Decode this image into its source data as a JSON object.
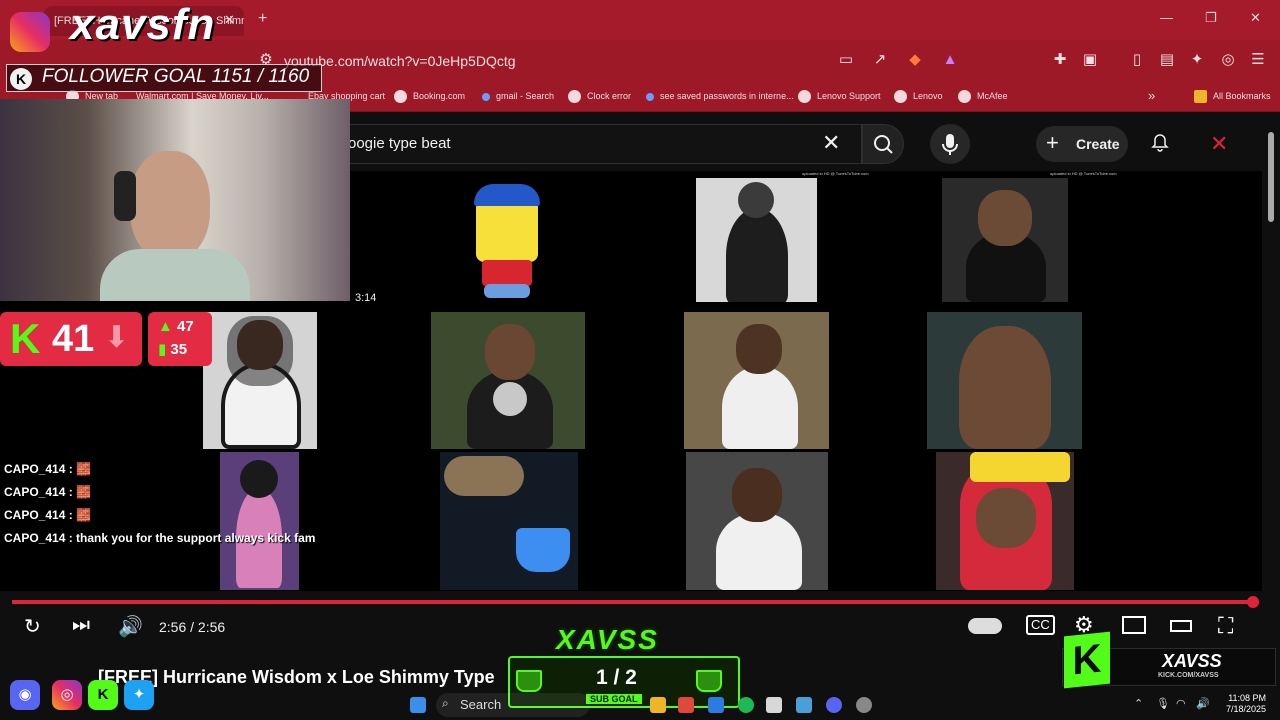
{
  "browser": {
    "tab_title": "[FREE] Hurricane Wisdom x Loe Shimmy",
    "url": "youtube.com/watch?v=0JeHp5DQctg",
    "bookmarks": [
      "New tab",
      "Walmart.com | Save Money. Liv...",
      "Ebay shopping cart",
      "Booking.com",
      "gmail - Search",
      "Clock error",
      "see saved passwords in interne...",
      "Lenovo Support",
      "Lenovo",
      "McAfee"
    ],
    "all_bookmarks": "All Bookmarks"
  },
  "youtube": {
    "search_query": "oogie type beat",
    "create_label": "Create",
    "thumb_duration": "3:14",
    "uploaded_note": "uploaded in HD @ TunesToTube.com",
    "time": "2:56 / 2:56",
    "video_title": "[FREE] Hurricane Wisdom x Loe Shimmy Type"
  },
  "stream": {
    "brand": "xavsfn",
    "follower_goal": "FOLLOWER GOAL 1151 / 1160",
    "viewers": "41",
    "stat_up": "47",
    "stat_bars": "35",
    "chat": [
      {
        "user": "CAPO_414",
        "msg": "🧱"
      },
      {
        "user": "CAPO_414",
        "msg": "🧱"
      },
      {
        "user": "CAPO_414",
        "msg": "🧱"
      },
      {
        "user": "CAPO_414",
        "msg": "thank you for the support always kick fam"
      }
    ],
    "sub_goal_title": "XAVSS",
    "sub_goal_count": "1 / 2",
    "sub_goal_label": "SUB GOAL",
    "kick_name": "XAVSS",
    "kick_url": "KICK.COM/XAVSS"
  },
  "taskbar": {
    "search": "Search",
    "clock_time": "11:08 PM",
    "clock_date": "7/18/2025"
  },
  "colors": {
    "chrome_red": "#a61b2c",
    "kick_green": "#53fc18",
    "yt_red": "#e0233b"
  }
}
